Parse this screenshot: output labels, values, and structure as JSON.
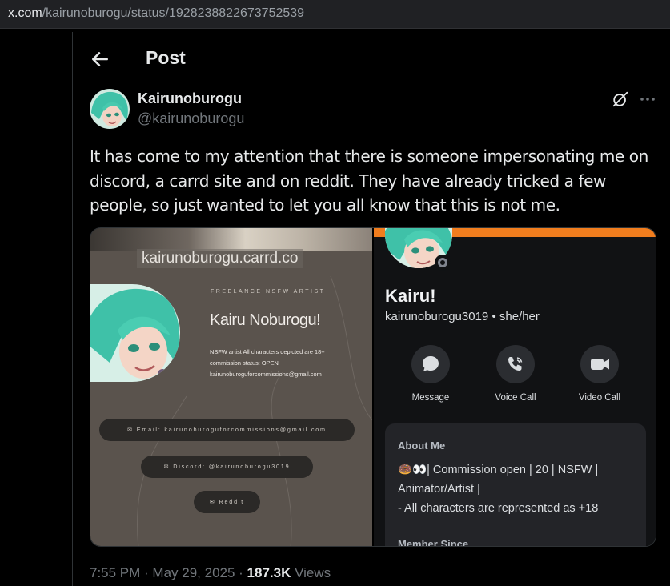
{
  "browser": {
    "url_domain": "x.com",
    "url_path": "/kairunoburogu/status/1928238822673752539"
  },
  "header": {
    "title": "Post"
  },
  "author": {
    "display_name": "Kairunoburogu",
    "handle": "@kairunoburogu"
  },
  "tweet": {
    "text": "It has come to my attention that there is someone impersonating me on discord, a carrd site and on reddit. They have already tricked a few people, so just wanted to let you all know that this is not me."
  },
  "media": {
    "carrd": {
      "url": "kairunoburogu.carrd.co",
      "subtitle": "FREELANCE NSFW ARTIST",
      "name": "Kairu Noburogu!",
      "bio_line1": "NSFW artist All characters depicted are 18+",
      "bio_line2": "commission status: OPEN",
      "bio_line3": "kairunoburoguforcommissions@gmail.com",
      "email_button": "✉  Email: kairunoburoguforcommissions@gmail.com",
      "discord_button": "✉  Discord: @kairunoburogu3019",
      "reddit_button": "✉  Reddit"
    },
    "discord": {
      "name": "Kairu!",
      "username": "kairunoburogu3019 • she/her",
      "actions": [
        {
          "label": "Message",
          "icon": "message-icon"
        },
        {
          "label": "Voice Call",
          "icon": "voice-call-icon"
        },
        {
          "label": "Video Call",
          "icon": "video-call-icon"
        }
      ],
      "about_title": "About Me",
      "about_emoji": "🍩👀",
      "about_line1": "| Commission open | 20 | NSFW |",
      "about_line2": "Animator/Artist |",
      "about_line3": "- All characters are represented as +18",
      "member_since": "Member Since",
      "banner_color": "#f07d1e"
    }
  },
  "meta": {
    "time": "7:55 PM · May 29, 2025 · ",
    "views_count": "187.3K",
    "views_label": " Views"
  }
}
